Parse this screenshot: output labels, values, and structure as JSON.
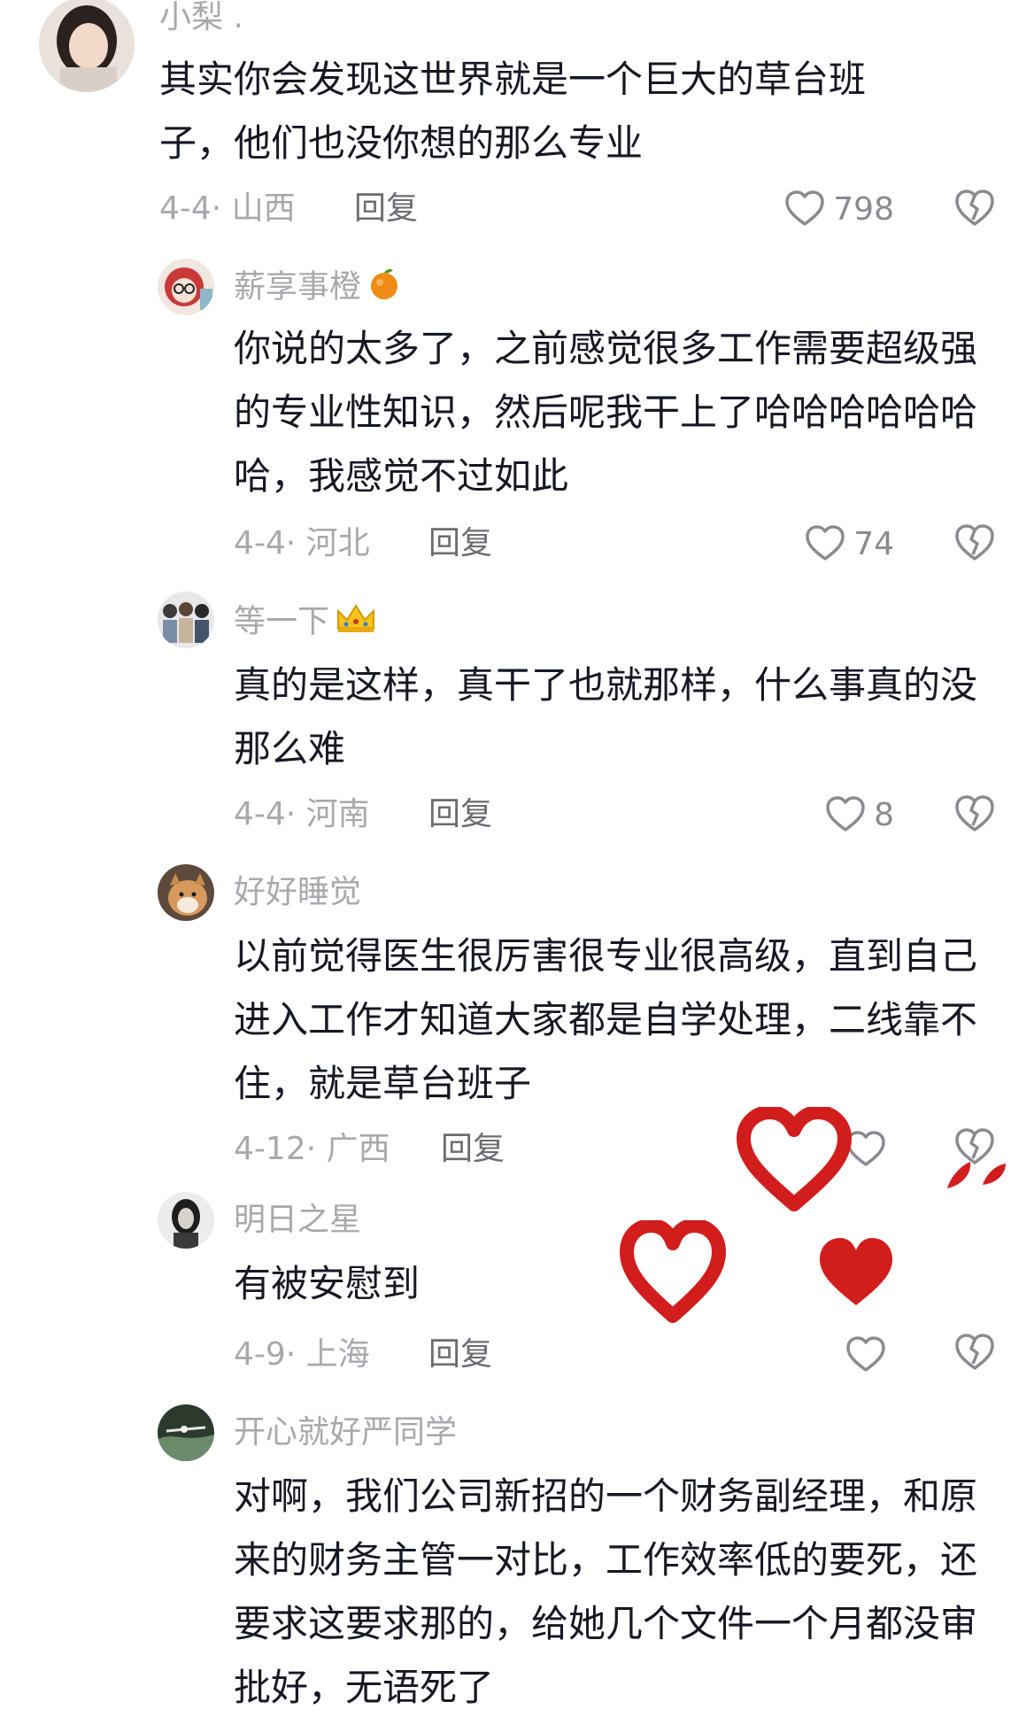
{
  "colors": {
    "text": "#161823",
    "muted": "#a7a9ae",
    "reply": "#6b6d73",
    "icon": "#8a8b91",
    "heart_red": "#d21d1d"
  },
  "comments": [
    {
      "user": "小梨 .",
      "text": "其实你会发现这世界就是一个巨大的草台班子，他们也没你想的那么专业",
      "meta": "4-4· 山西",
      "reply": "回复",
      "likes": "798"
    },
    {
      "user": "薪享事橙",
      "emoji": "orange-emoji",
      "text": "你说的太多了，之前感觉很多工作需要超级强的专业性知识，然后呢我干上了哈哈哈哈哈哈哈，我感觉不过如此",
      "meta": "4-4· 河北",
      "reply": "回复",
      "likes": "74"
    },
    {
      "user": "等一下",
      "emoji": "crown-emoji",
      "text": "真的是这样，真干了也就那样，什么事真的没那么难",
      "meta": "4-4· 河南",
      "reply": "回复",
      "likes": "8"
    },
    {
      "user": "好好睡觉",
      "text": "以前觉得医生很厉害很专业很高级，直到自己进入工作才知道大家都是自学处理，二线靠不住，就是草台班子",
      "meta": "4-12· 广西",
      "reply": "回复",
      "likes": ""
    },
    {
      "user": "明日之星",
      "text": "有被安慰到",
      "meta": "4-9· 上海",
      "reply": "回复",
      "likes": ""
    },
    {
      "user": "开心就好严同学",
      "text": "对啊，我们公司新招的一个财务副经理，和原来的财务主管一对比，工作效率低的要死，还要求这要求那的，给她几个文件一个月都没审批好，无语死了",
      "meta": "",
      "reply": "",
      "likes": ""
    }
  ]
}
